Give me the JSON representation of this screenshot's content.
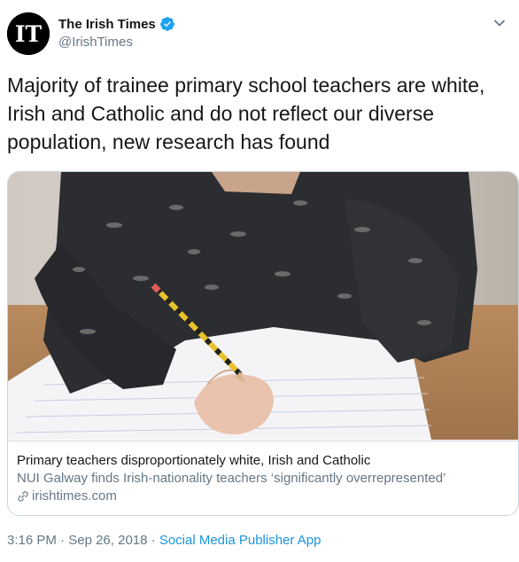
{
  "author": {
    "display_name": "The Irish Times",
    "handle": "@IrishTimes",
    "avatar_logo": "IT",
    "verified": true
  },
  "tweet": {
    "text": "Majority of trainee primary school teachers are white, Irish and Catholic and do not reflect our diverse population, new research has found"
  },
  "card": {
    "title": "Primary teachers disproportionately white, Irish and Catholic",
    "description": "NUI Galway finds Irish-nationality teachers ‘significantly overrepresented’",
    "domain": "irishtimes.com",
    "image_icon": "photo-child-writing-with-pencil"
  },
  "meta": {
    "time": "3:16 PM",
    "separator": " · ",
    "date": "Sep 26, 2018",
    "source": "Social Media Publisher App"
  },
  "colors": {
    "link": "#1b95e0",
    "secondary_text": "#657786",
    "border": "#ccd6dd",
    "verified_badge": "#1da1f2"
  }
}
